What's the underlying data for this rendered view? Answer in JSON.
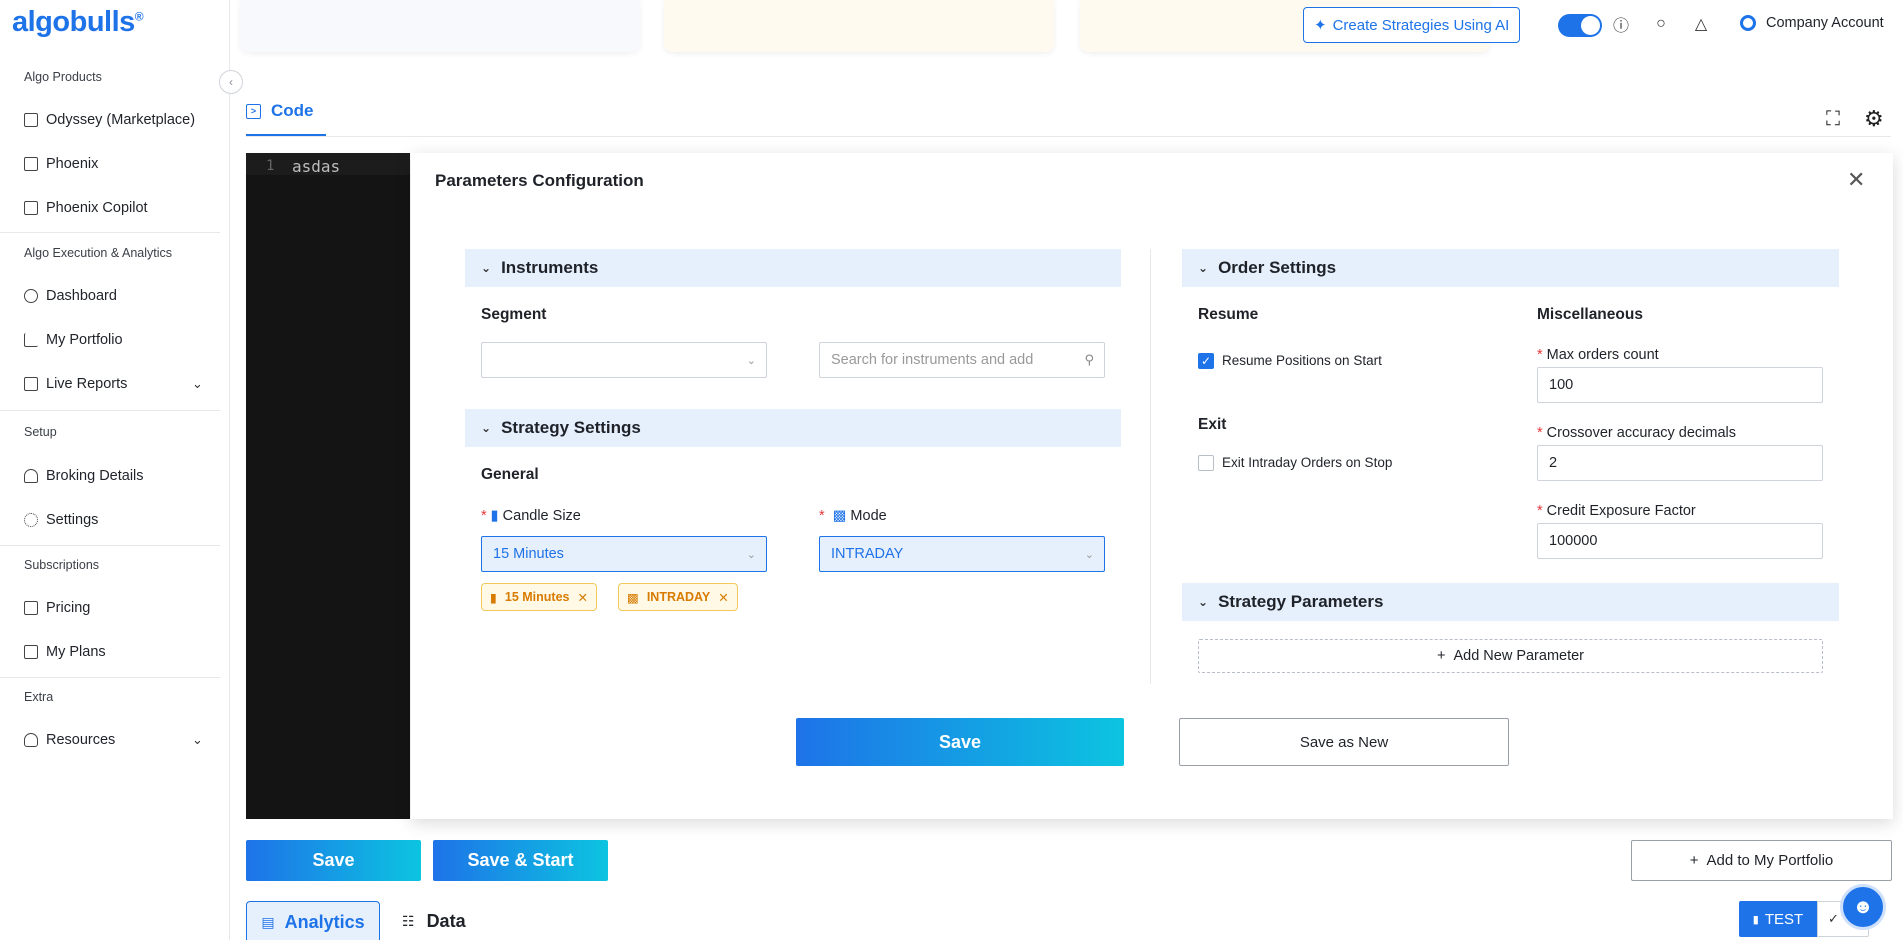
{
  "brand": {
    "logo": "algobulls",
    "registered": "®"
  },
  "sidebar": {
    "groups": [
      {
        "label": "Algo Products"
      },
      {
        "label": "Algo Execution & Analytics"
      },
      {
        "label": "Setup"
      },
      {
        "label": "Subscriptions"
      },
      {
        "label": "Extra"
      }
    ],
    "items": [
      {
        "label": "Odyssey (Marketplace)",
        "icon": "store-icon"
      },
      {
        "label": "Phoenix",
        "icon": "terminal-icon"
      },
      {
        "label": "Phoenix Copilot",
        "icon": "copilot-icon"
      },
      {
        "label": "Dashboard",
        "icon": "dashboard-icon"
      },
      {
        "label": "My Portfolio",
        "icon": "chart-icon"
      },
      {
        "label": "Live Reports",
        "icon": "report-icon"
      },
      {
        "label": "Broking Details",
        "icon": "broker-icon"
      },
      {
        "label": "Settings",
        "icon": "gear-icon"
      },
      {
        "label": "Pricing",
        "icon": "pricing-icon"
      },
      {
        "label": "My Plans",
        "icon": "plans-icon"
      },
      {
        "label": "Resources",
        "icon": "bulb-icon"
      }
    ]
  },
  "header": {
    "ai_button": "Create Strategies Using AI",
    "account": "Company Account"
  },
  "code_tab": {
    "label": "Code"
  },
  "editor": {
    "line_number": "1",
    "content": "asdas"
  },
  "modal": {
    "title": "Parameters Configuration",
    "instruments": {
      "header": "Instruments",
      "segment_label": "Segment",
      "segment_value": "",
      "search_placeholder": "Search for instruments and add"
    },
    "strategy_settings": {
      "header": "Strategy Settings",
      "general_label": "General",
      "candle_label": "Candle Size",
      "candle_value": "15 Minutes",
      "mode_label": "Mode",
      "mode_value": "INTRADAY",
      "tags": [
        "15 Minutes",
        "INTRADAY"
      ]
    },
    "order_settings": {
      "header": "Order Settings",
      "resume_label": "Resume",
      "resume_checkbox": "Resume Positions on Start",
      "resume_checked": true,
      "exit_label": "Exit",
      "exit_checkbox": "Exit Intraday Orders on Stop",
      "exit_checked": false,
      "misc_label": "Miscellaneous",
      "max_orders_label": "Max orders count",
      "max_orders_value": "100",
      "crossover_label": "Crossover accuracy decimals",
      "crossover_value": "2",
      "credit_label": "Credit Exposure Factor",
      "credit_value": "100000"
    },
    "strategy_parameters": {
      "header": "Strategy Parameters",
      "add_button": "Add New Parameter"
    },
    "save_button": "Save",
    "save_as_new_button": "Save as New"
  },
  "bottom": {
    "save": "Save",
    "save_start": "Save & Start",
    "add_portfolio": "Add to My Portfolio",
    "analytics_tab": "Analytics",
    "data_tab": "Data",
    "test": "TEST"
  },
  "colors": {
    "accent": "#1e73e8",
    "tag": "#d97b00",
    "section_bg": "#e6effc"
  }
}
